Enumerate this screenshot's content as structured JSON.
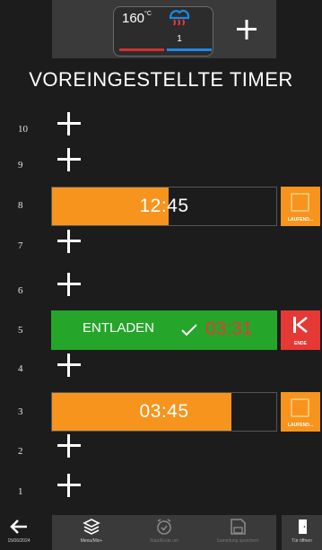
{
  "header": {
    "temperature": "160",
    "temperature_unit": "°C",
    "steam_level": "1",
    "temp_color": "#d32f2f",
    "steam_color": "#1e88e5"
  },
  "title": "VOREINGESTELLTE TIMER",
  "rows": [
    {
      "number": "10",
      "state": "empty"
    },
    {
      "number": "9",
      "state": "empty"
    },
    {
      "number": "8",
      "state": "running",
      "time": "12:45",
      "button_label": "LAUFEND...",
      "progress": 0.52
    },
    {
      "number": "7",
      "state": "empty"
    },
    {
      "number": "6",
      "state": "empty"
    },
    {
      "number": "5",
      "state": "unload",
      "label": "ENTLADEN",
      "time": "03:31",
      "button_label": "ENDE"
    },
    {
      "number": "4",
      "state": "empty"
    },
    {
      "number": "3",
      "state": "running",
      "time": "03:45",
      "button_label": "LAUFEND...",
      "progress": 0.8
    },
    {
      "number": "2",
      "state": "empty"
    },
    {
      "number": "1",
      "state": "empty"
    }
  ],
  "bottom": {
    "date": "15/06/2024",
    "menu_label": "Menu/Mix+",
    "start_label": "Start/Ende um",
    "save_label": "Sammlung speichern",
    "door_label": "Tür öffnen"
  },
  "colors": {
    "accent_orange": "#f7941d",
    "unload_green": "#25a52a",
    "end_red": "#e53935"
  }
}
